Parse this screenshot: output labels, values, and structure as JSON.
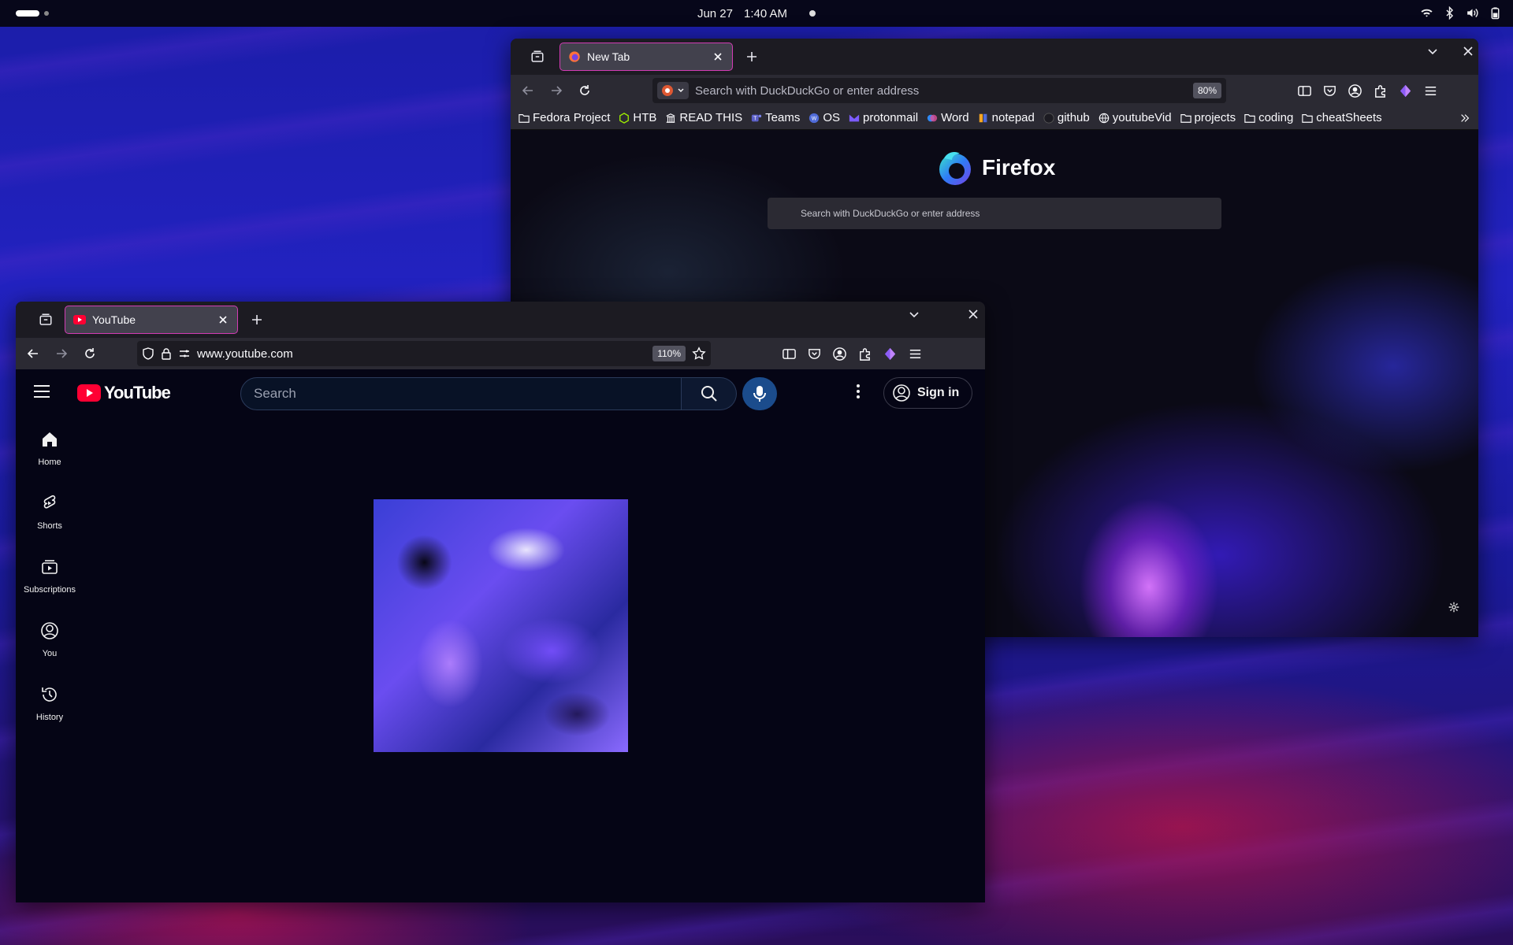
{
  "topbar": {
    "date": "Jun 27",
    "time": "1:40 AM"
  },
  "firefox_window": {
    "tab": {
      "title": "New Tab"
    },
    "urlbar": {
      "placeholder": "Search with DuckDuckGo or enter address",
      "zoom": "80%"
    },
    "bookmarks": [
      {
        "label": "Fedora Project",
        "icon": "folder-icon"
      },
      {
        "label": "HTB",
        "icon": "cube-icon"
      },
      {
        "label": "READ THIS",
        "icon": "building-icon"
      },
      {
        "label": "Teams",
        "icon": "teams-icon"
      },
      {
        "label": "OS",
        "icon": "wordpress-icon"
      },
      {
        "label": "protonmail",
        "icon": "mail-icon"
      },
      {
        "label": "Word",
        "icon": "copilot-icon"
      },
      {
        "label": "notepad",
        "icon": "notepad-icon"
      },
      {
        "label": "github",
        "icon": "github-icon"
      },
      {
        "label": "youtubeVid",
        "icon": "globe-icon"
      },
      {
        "label": "projects",
        "icon": "folder-icon"
      },
      {
        "label": "coding",
        "icon": "folder-icon"
      },
      {
        "label": "cheatSheets",
        "icon": "folder-icon"
      }
    ],
    "newtab": {
      "brand": "Firefox",
      "search_placeholder": "Search with DuckDuckGo or enter address"
    }
  },
  "youtube_window": {
    "tab": {
      "title": "YouTube"
    },
    "urlbar": {
      "url": "www.youtube.com",
      "zoom": "110%"
    },
    "page": {
      "logo_text": "YouTube",
      "search_placeholder": "Search",
      "signin_label": "Sign in",
      "sidebar": [
        {
          "label": "Home",
          "icon": "home-icon"
        },
        {
          "label": "Shorts",
          "icon": "shorts-icon"
        },
        {
          "label": "Subscriptions",
          "icon": "subscriptions-icon"
        },
        {
          "label": "You",
          "icon": "user-circle-icon"
        },
        {
          "label": "History",
          "icon": "history-icon"
        }
      ]
    }
  },
  "colors": {
    "tab_accent": "#d23bb4",
    "youtube_red": "#ff0033",
    "firefox_orange": "#ff7139"
  }
}
